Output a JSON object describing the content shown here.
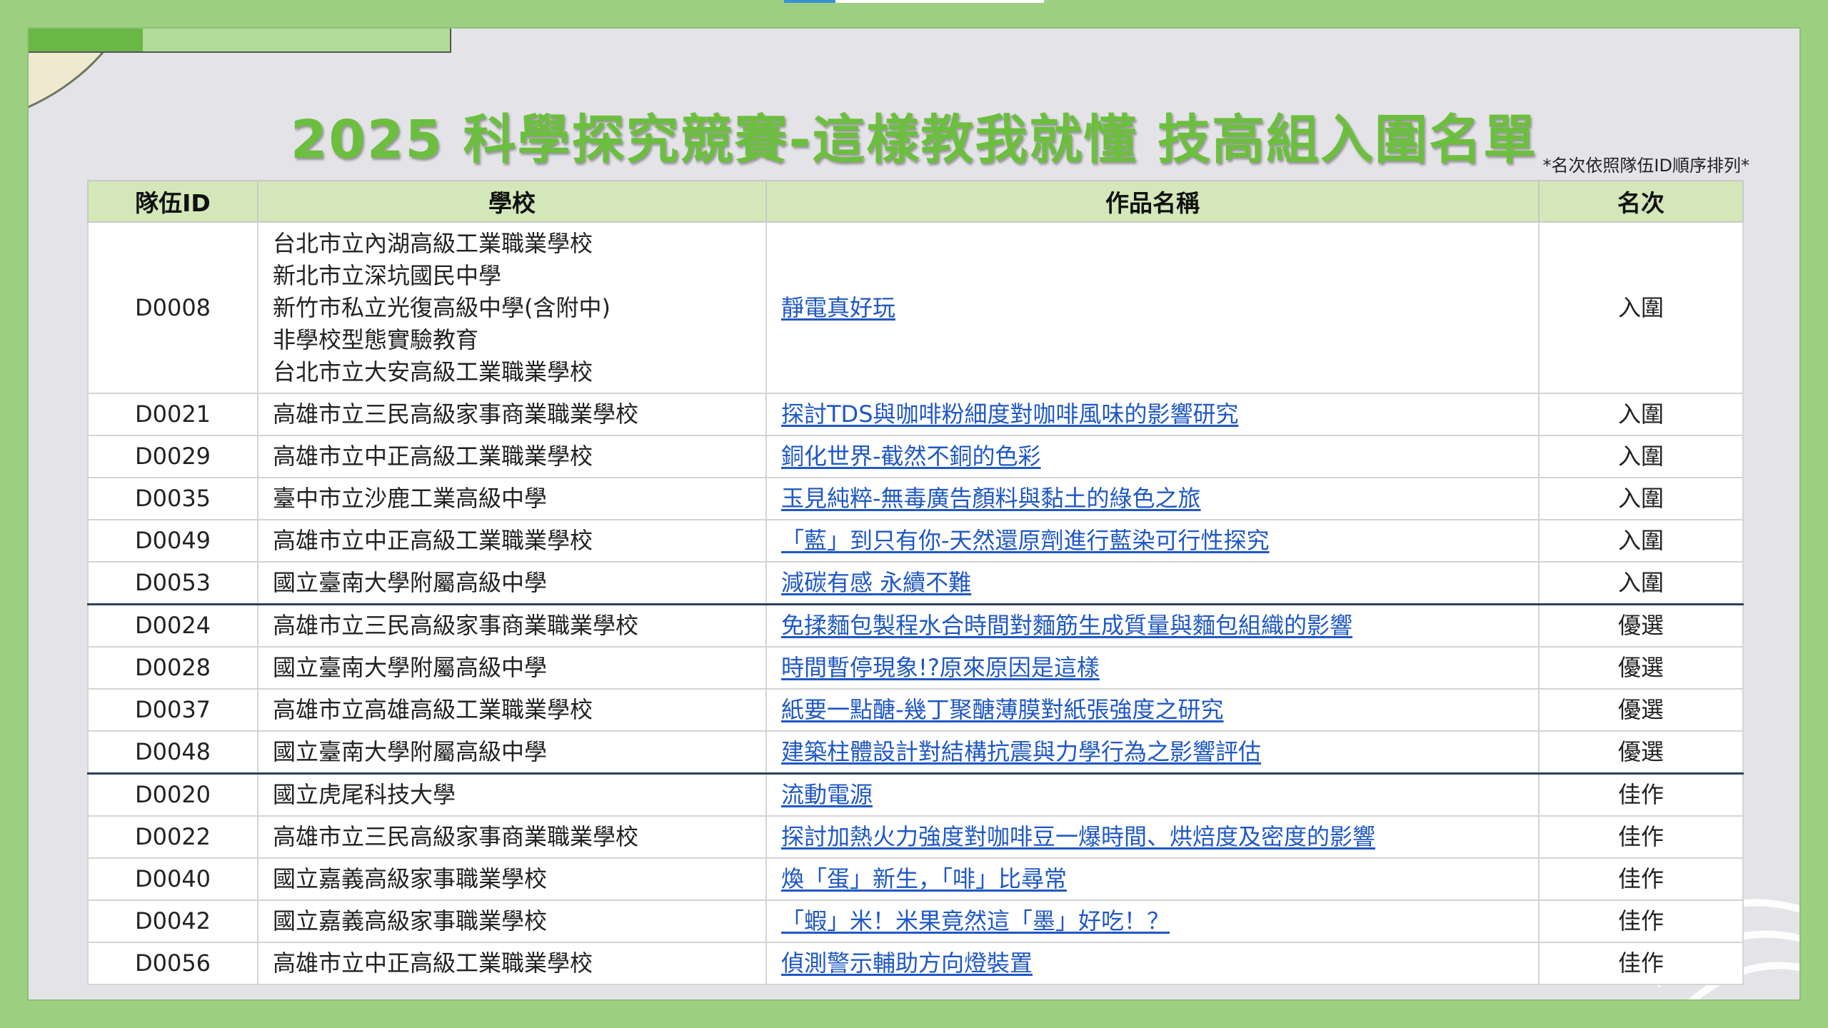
{
  "title": "2025 科學探究競賽-這樣教我就懂 技高組入圍名單",
  "note": "*名次依照隊伍ID順序排列*",
  "headers": [
    "隊伍ID",
    "學校",
    "作品名稱",
    "名次"
  ],
  "rows": [
    {
      "id": "D0008",
      "schools": [
        "台北市立內湖高級工業職業學校",
        "新北市立深坑國民中學",
        "新竹市私立光復高級中學(含附中)",
        "非學校型態實驗教育",
        "台北市立大安高級工業職業學校"
      ],
      "work": "靜電真好玩",
      "rank": "入圍"
    },
    {
      "id": "D0021",
      "schools": [
        "高雄市立三民高級家事商業職業學校"
      ],
      "work": "探討TDS與咖啡粉細度對咖啡風味的影響研究",
      "rank": "入圍"
    },
    {
      "id": "D0029",
      "schools": [
        "高雄市立中正高級工業職業學校"
      ],
      "work": "銅化世界-截然不銅的色彩",
      "rank": "入圍"
    },
    {
      "id": "D0035",
      "schools": [
        "臺中市立沙鹿工業高級中學"
      ],
      "work": "玉見純粹-無毒廣告顏料與黏土的綠色之旅",
      "rank": "入圍"
    },
    {
      "id": "D0049",
      "schools": [
        "高雄市立中正高級工業職業學校"
      ],
      "work": "「藍」到只有你-天然還原劑進行藍染可行性探究",
      "rank": "入圍"
    },
    {
      "id": "D0053",
      "schools": [
        "國立臺南大學附屬高級中學"
      ],
      "work": "減碳有感 永續不難",
      "rank": "入圍"
    },
    {
      "id": "D0024",
      "schools": [
        "高雄市立三民高級家事商業職業學校"
      ],
      "work": "免揉麵包製程水合時間對麵筋生成質量與麵包組織的影響",
      "rank": "優選"
    },
    {
      "id": "D0028",
      "schools": [
        "國立臺南大學附屬高級中學"
      ],
      "work": "時間暫停現象!?原來原因是這樣",
      "rank": "優選"
    },
    {
      "id": "D0037",
      "schools": [
        "高雄市立高雄高級工業職業學校"
      ],
      "work": "紙要一點醣-幾丁聚醣薄膜對紙張強度之研究",
      "rank": "優選"
    },
    {
      "id": "D0048",
      "schools": [
        "國立臺南大學附屬高級中學"
      ],
      "work": "建築柱體設計對結構抗震與力學行為之影響評估",
      "rank": "優選"
    },
    {
      "id": "D0020",
      "schools": [
        "國立虎尾科技大學"
      ],
      "work": "流動電源",
      "rank": "佳作"
    },
    {
      "id": "D0022",
      "schools": [
        "高雄市立三民高級家事商業職業學校"
      ],
      "work": "探討加熱火力強度對咖啡豆一爆時間、烘焙度及密度的影響",
      "rank": "佳作"
    },
    {
      "id": "D0040",
      "schools": [
        "國立嘉義高級家事職業學校"
      ],
      "work": "煥「蛋」新生，「啡」比尋常",
      "rank": "佳作"
    },
    {
      "id": "D0042",
      "schools": [
        "國立嘉義高級家事職業學校"
      ],
      "work": "「蝦」米！米果竟然這「墨」好吃！？",
      "rank": "佳作"
    },
    {
      "id": "D0056",
      "schools": [
        "高雄市立中正高級工業職業學校"
      ],
      "work": "偵測警示輔助方向燈裝置",
      "rank": "佳作"
    }
  ],
  "colors": {
    "title": "#6cbf3e",
    "header_bg": "#d3e7b8",
    "link": "#1f58c4",
    "frame": "#9ccf80"
  }
}
